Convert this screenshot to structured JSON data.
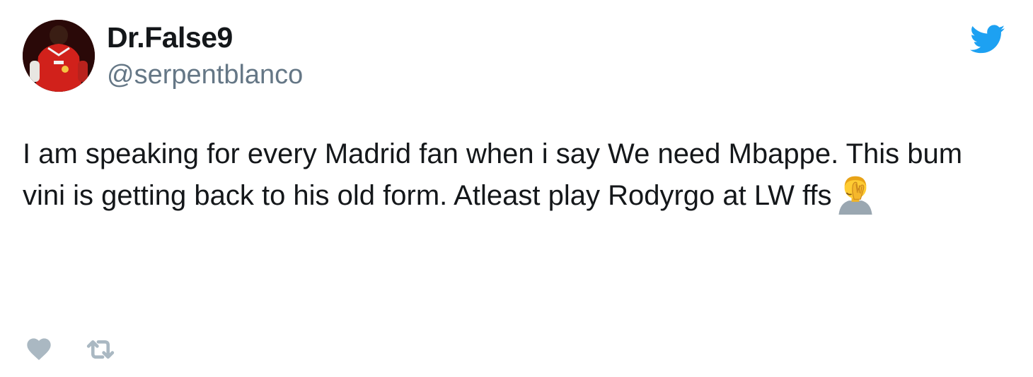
{
  "tweet": {
    "author": {
      "display_name": "Dr.False9",
      "handle": "@serpentblanco",
      "avatar_icon": "avatar-photo"
    },
    "brand_icon": "twitter-bird-icon",
    "text": "I am speaking for every Madrid fan when i say We need Mbappe. This bum vini is getting back to his old form. Atleast play Rodyrgo at LW ffs",
    "emoji": "face-palm-emoji",
    "actions": {
      "like_icon": "heart-icon",
      "retweet_icon": "retweet-icon"
    }
  },
  "colors": {
    "brand": "#1da1f2",
    "text": "#14171a",
    "secondary_text": "#657786",
    "action_icon": "#aab8c2"
  }
}
